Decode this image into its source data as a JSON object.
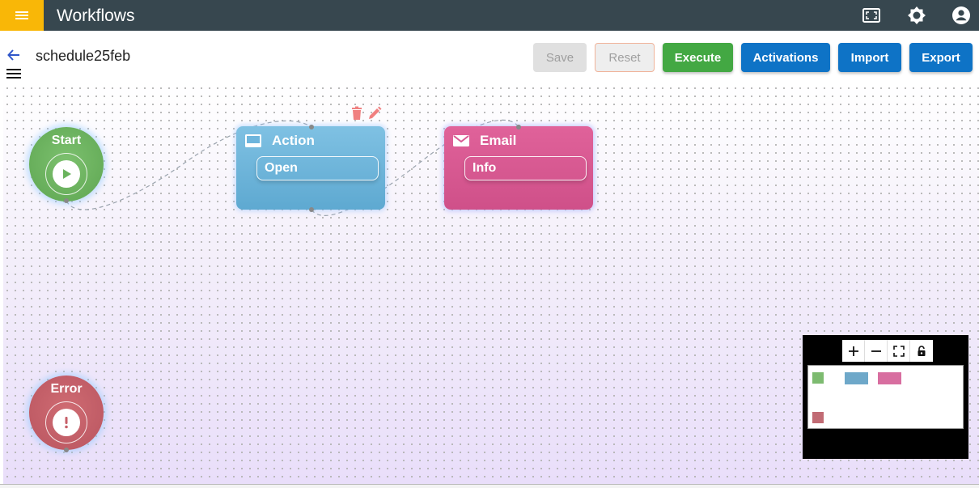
{
  "app": {
    "title": "Workflows"
  },
  "workflow": {
    "name": "schedule25feb"
  },
  "toolbar": {
    "save_label": "Save",
    "reset_label": "Reset",
    "execute_label": "Execute",
    "activations_label": "Activations",
    "import_label": "Import",
    "export_label": "Export"
  },
  "nodes": {
    "start": {
      "label": "Start",
      "icon": "play-icon",
      "color": "#6ab35d"
    },
    "error": {
      "label": "Error",
      "icon": "exclamation-icon",
      "color": "#c65f68"
    },
    "action": {
      "label": "Action",
      "value": "Open",
      "icon": "monitor-icon",
      "color": "#6eb5dc"
    },
    "email": {
      "label": "Email",
      "value": "Info",
      "icon": "mail-icon",
      "color": "#d85a93"
    }
  },
  "minimap": {
    "controls": [
      "zoom-in",
      "zoom-out",
      "fit-view",
      "lock"
    ]
  },
  "colors": {
    "topbar": "#37474f",
    "menu": "#f9b707",
    "primary": "#0e73c6",
    "success": "#43a843"
  }
}
